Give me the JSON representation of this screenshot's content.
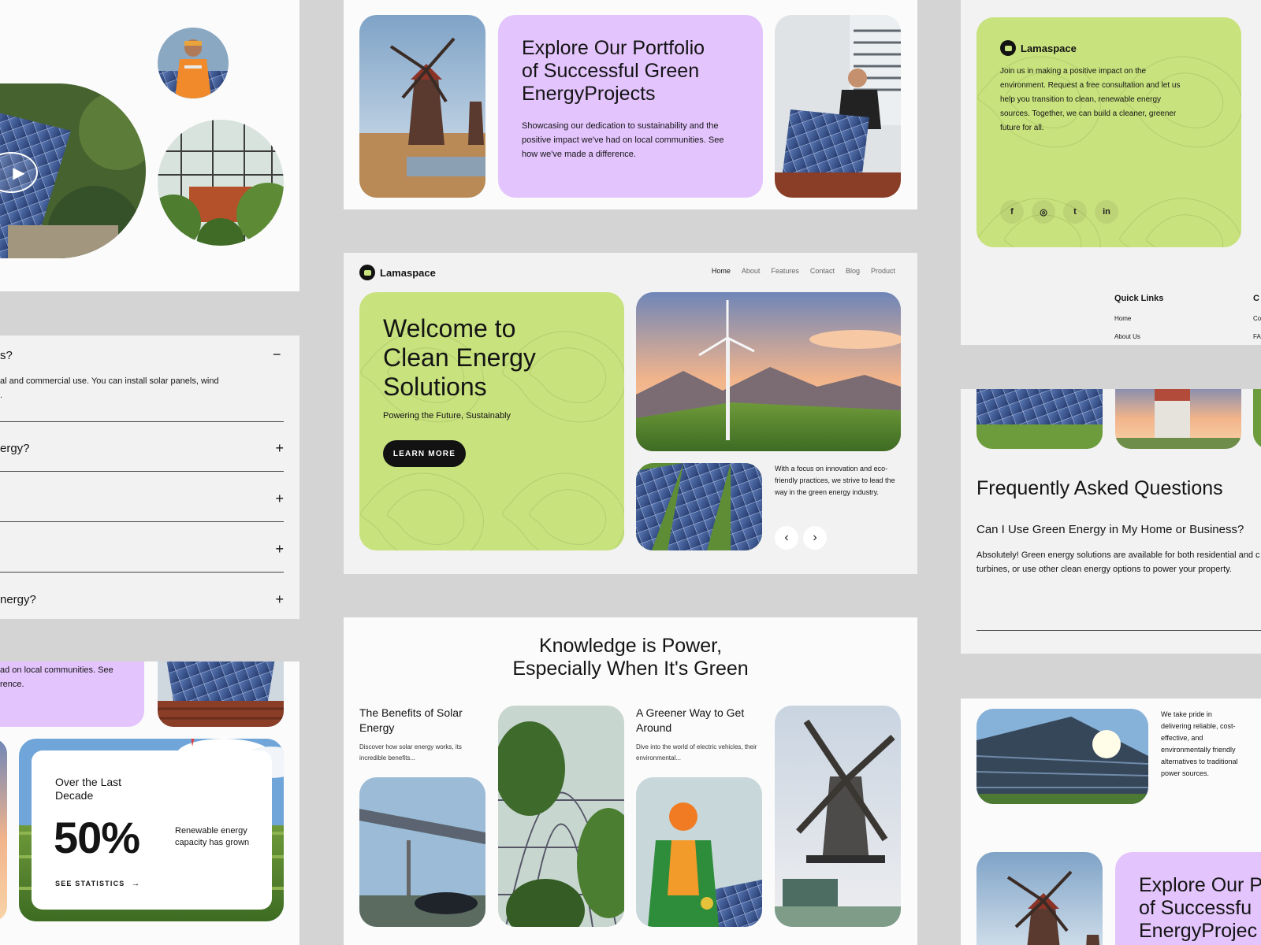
{
  "brand": {
    "name": "Lamaspace"
  },
  "nav": [
    "Home",
    "About",
    "Features",
    "Contact",
    "Blog",
    "Product"
  ],
  "hero": {
    "title_lines": [
      "Welcome to",
      "Clean Energy",
      "Solutions"
    ],
    "subtitle": "Powering the Future, Sustainably",
    "cta": "LEARN MORE",
    "side_text": "With a focus on innovation and eco-friendly practices, we strive to lead the way in the green energy industry.",
    "prev_icon": "chevron-left-icon",
    "next_icon": "chevron-right-icon"
  },
  "portfolio": {
    "title_lines": [
      "Explore Our Portfolio",
      "of Successful Green",
      "EnergyProjects"
    ],
    "text": "Showcasing our dedication to sustainability and the positive impact we've had on local communities. See how we've made a difference.",
    "partial_text_lines": [
      "ad on local communities. See",
      "rence."
    ],
    "partial_title_lines": [
      "Explore Our P",
      "of Successfu",
      "EnergyProjec"
    ]
  },
  "footer_card": {
    "text": "Join us in making a positive impact on the environment. Request a free consultation and let us help you transition to clean, renewable energy sources. Together, we can build a cleaner, greener future for all.",
    "social": [
      "f",
      "◎",
      "t",
      "in"
    ],
    "quick_links_title": "Quick Links",
    "quick_links": [
      "Home",
      "About Us"
    ],
    "col2_title": "C",
    "col2_links": [
      "Co",
      "FA"
    ]
  },
  "faq_left": {
    "open_q": "s?",
    "open_a_lines": [
      "al and commercial use. You can install solar panels, wind",
      "."
    ],
    "rows": [
      "ergy?",
      "",
      "",
      "nergy?"
    ],
    "minus": "−",
    "plus": "+"
  },
  "faq_right": {
    "title": "Frequently Asked Questions",
    "question": "Can I Use Green Energy in My Home or Business?",
    "answer_lines": [
      "Absolutely! Green energy solutions are available for both residential and c",
      "turbines, or use other clean energy options to power your property."
    ]
  },
  "knowledge": {
    "title_lines": [
      "Knowledge is Power,",
      "Especially When It's Green"
    ],
    "a1_title": "The Benefits of Solar Energy",
    "a1_text": "Discover how solar energy works, its incredible benefits...",
    "a2_title": "A Greener Way to Get Around",
    "a2_text": "Dive into the world of electric vehicles, their environmental..."
  },
  "stats": {
    "label": "Over the Last Decade",
    "value": "50%",
    "desc": "Renewable energy capacity has grown",
    "cta": "SEE STATISTICS",
    "arrow": "→"
  },
  "about_br": {
    "text": "We take pride in delivering reliable, cost-effective, and environmentally friendly alternatives to traditional power sources."
  },
  "colors": {
    "green": "#c8e27e",
    "purple": "#e3c4fd",
    "dark": "#121212",
    "bg": "#d4d4d4"
  }
}
